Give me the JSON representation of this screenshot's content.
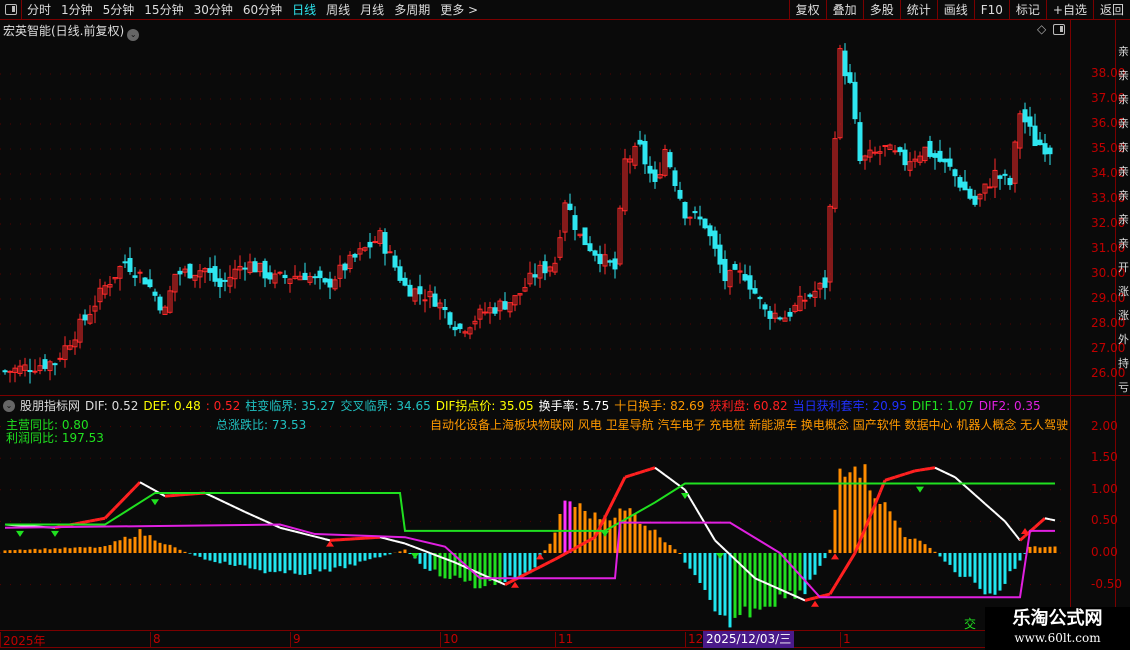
{
  "toolbar": {
    "left": [
      "分时",
      "1分钟",
      "5分钟",
      "15分钟",
      "30分钟",
      "60分钟",
      "日线",
      "周线",
      "月线",
      "多周期",
      "更多 >"
    ],
    "active": "日线",
    "right": [
      "复权",
      "叠加",
      "多股",
      "统计",
      "画线",
      "F10",
      "标记",
      "+自选",
      "返回"
    ]
  },
  "stock_title": "宏英智能(日线.前复权)",
  "price_axis": [
    "38.00",
    "37.00",
    "36.00",
    "35.00",
    "34.00",
    "33.00",
    "32.00",
    "31.00",
    "30.00",
    "29.00",
    "28.00",
    "27.00",
    "26.00"
  ],
  "indicator_axis": [
    "2.00",
    "1.50",
    "1.00",
    "0.50",
    "0.00",
    "-0.50"
  ],
  "right_strip": "亲亲亲亲亲亲亲亲亲开涨涨外持亏",
  "indicator_header": [
    {
      "t": "股朋指标网",
      "c": "#dddddd"
    },
    {
      "t": "DIF: 0.52",
      "c": "#dddddd"
    },
    {
      "t": "DEF: 0.48",
      "c": "#ffff00"
    },
    {
      "t": ": 0.52",
      "c": "#ff2020"
    },
    {
      "t": "柱变临界: 35.27",
      "c": "#20c0c0"
    },
    {
      "t": "交叉临界: 34.65",
      "c": "#20c0c0"
    },
    {
      "t": "DIF拐点价: 35.05",
      "c": "#ffff00"
    },
    {
      "t": "换手率: 5.75",
      "c": "#ffffff"
    },
    {
      "t": "十日换手: 82.69",
      "c": "#ff9900"
    },
    {
      "t": "获利盘: 60.82",
      "c": "#ff2020"
    },
    {
      "t": "当日获利套牢: 20.95",
      "c": "#2030ff"
    },
    {
      "t": "DIF1: 1.07",
      "c": "#20e020"
    },
    {
      "t": "DIF2: 0.35",
      "c": "#e020e0"
    }
  ],
  "main_yoy": "主营同比: 0.80",
  "profit_yoy": "利润同比: 197.53",
  "total_ratio": "总涨跌比: 73.53",
  "concepts": "自动化设备上海板块物联网 风电 卫星导航 汽车电子 充电桩 新能源车 换电概念 国产软件 数据中心 机器人概念 无人驾驶 人",
  "date_axis": [
    {
      "t": "2025年",
      "i": 0
    },
    {
      "t": "8",
      "i": 30
    },
    {
      "t": "9",
      "i": 58
    },
    {
      "t": "10",
      "i": 88
    },
    {
      "t": "11",
      "i": 111
    },
    {
      "t": "12",
      "i": 137
    },
    {
      "t": "1",
      "i": 168
    }
  ],
  "date_highlight": "2025/12/03/三",
  "corner_label": "交",
  "watermark": {
    "name": "乐淘公式网",
    "url": "www.60lt.com"
  },
  "colors": {
    "up": "#ff2a2a",
    "down": "#2ee6f0",
    "grid": "#7a0000"
  },
  "chart_data": [
    {
      "type": "candlestick",
      "title": "宏英智能 日线",
      "ylim": [
        25.5,
        39
      ],
      "price_path": [
        [
          0,
          26.1
        ],
        [
          10,
          26.5
        ],
        [
          16,
          28.2
        ],
        [
          20,
          29.5
        ],
        [
          24,
          30.5
        ],
        [
          28,
          29.8
        ],
        [
          32,
          28.5
        ],
        [
          34,
          30.0
        ],
        [
          40,
          30.2
        ],
        [
          43,
          29.5
        ],
        [
          48,
          30.5
        ],
        [
          54,
          29.8
        ],
        [
          60,
          30.0
        ],
        [
          64,
          29.5
        ],
        [
          68,
          30.3
        ],
        [
          75,
          31.5
        ],
        [
          80,
          29.5
        ],
        [
          86,
          29.0
        ],
        [
          91,
          27.8
        ],
        [
          96,
          28.5
        ],
        [
          102,
          29.0
        ],
        [
          106,
          30.0
        ],
        [
          110,
          30.5
        ],
        [
          112,
          33.0
        ],
        [
          115,
          31.5
        ],
        [
          120,
          30.5
        ],
        [
          122,
          30.2
        ],
        [
          124,
          34.5
        ],
        [
          127,
          35.0
        ],
        [
          130,
          33.5
        ],
        [
          132,
          35.0
        ],
        [
          136,
          32.5
        ],
        [
          140,
          32.0
        ],
        [
          144,
          29.8
        ],
        [
          148,
          30.0
        ],
        [
          152,
          28.5
        ],
        [
          156,
          28.3
        ],
        [
          160,
          29.0
        ],
        [
          164,
          29.6
        ],
        [
          165,
          32.6
        ],
        [
          167,
          38.8
        ],
        [
          169,
          37.5
        ],
        [
          171,
          34.5
        ],
        [
          176,
          35.0
        ],
        [
          180,
          34.5
        ],
        [
          184,
          35.0
        ],
        [
          189,
          34.2
        ],
        [
          194,
          32.8
        ],
        [
          198,
          34.0
        ],
        [
          201,
          33.6
        ],
        [
          203,
          36.5
        ],
        [
          206,
          35.3
        ],
        [
          209,
          35.0
        ]
      ]
    },
    {
      "type": "line",
      "title": "股朋指标网",
      "ylim": [
        -1.2,
        2.3
      ],
      "series": [
        {
          "name": "DIF",
          "color": "#ffffff",
          "points": [
            [
              0,
              0.45
            ],
            [
              10,
              0.4
            ],
            [
              20,
              0.55
            ],
            [
              27,
              1.12
            ],
            [
              32,
              0.9
            ],
            [
              40,
              0.95
            ],
            [
              48,
              0.65
            ],
            [
              55,
              0.4
            ],
            [
              65,
              0.2
            ],
            [
              75,
              0.25
            ],
            [
              80,
              0.15
            ],
            [
              90,
              -0.15
            ],
            [
              100,
              -0.5
            ],
            [
              110,
              -0.1
            ],
            [
              118,
              0.25
            ],
            [
              124,
              1.2
            ],
            [
              130,
              1.35
            ],
            [
              136,
              1.0
            ],
            [
              142,
              0.2
            ],
            [
              150,
              -0.4
            ],
            [
              160,
              -0.75
            ],
            [
              165,
              -0.65
            ],
            [
              170,
              0.0
            ],
            [
              176,
              1.15
            ],
            [
              182,
              1.3
            ],
            [
              186,
              1.35
            ],
            [
              190,
              1.2
            ],
            [
              200,
              0.5
            ],
            [
              203,
              0.2
            ],
            [
              208,
              0.55
            ],
            [
              211,
              0.5
            ]
          ]
        },
        {
          "name": "DIF1",
          "color": "#20e020",
          "points": [
            [
              0,
              0.45
            ],
            [
              20,
              0.45
            ],
            [
              30,
              0.95
            ],
            [
              79,
              0.95
            ],
            [
              80,
              0.35
            ],
            [
              120,
              0.35
            ],
            [
              130,
              0.8
            ],
            [
              136,
              1.1
            ],
            [
              210,
              1.1
            ]
          ]
        },
        {
          "name": "DIF2",
          "color": "#e020e0",
          "points": [
            [
              0,
              0.4
            ],
            [
              55,
              0.45
            ],
            [
              62,
              0.3
            ],
            [
              80,
              0.25
            ],
            [
              88,
              0.1
            ],
            [
              95,
              -0.4
            ],
            [
              122,
              -0.4
            ],
            [
              123,
              0.48
            ],
            [
              145,
              0.48
            ],
            [
              155,
              0.0
            ],
            [
              163,
              -0.7
            ],
            [
              203,
              -0.7
            ],
            [
              205,
              0.35
            ],
            [
              210,
              0.35
            ]
          ]
        },
        {
          "name": "histogram",
          "type": "bar",
          "points": [
            [
              0,
              0.05
            ],
            [
              20,
              0.1
            ],
            [
              27,
              0.35
            ],
            [
              35,
              0.05
            ],
            [
              40,
              -0.1
            ],
            [
              55,
              -0.35
            ],
            [
              65,
              -0.3
            ],
            [
              80,
              0.05
            ],
            [
              85,
              -0.3
            ],
            [
              95,
              -0.55
            ],
            [
              105,
              -0.35
            ],
            [
              110,
              0.3
            ],
            [
              112,
              0.9
            ],
            [
              118,
              0.6
            ],
            [
              125,
              0.7
            ],
            [
              135,
              0.0
            ],
            [
              140,
              -0.7
            ],
            [
              143,
              -1.2
            ],
            [
              150,
              -0.9
            ],
            [
              160,
              -0.6
            ],
            [
              165,
              0.05
            ],
            [
              167,
              1.4
            ],
            [
              170,
              1.6
            ],
            [
              175,
              0.9
            ],
            [
              180,
              0.3
            ],
            [
              185,
              0.1
            ],
            [
              190,
              -0.3
            ],
            [
              198,
              -0.7
            ],
            [
              205,
              0.1
            ],
            [
              210,
              0.1
            ]
          ]
        }
      ]
    }
  ]
}
